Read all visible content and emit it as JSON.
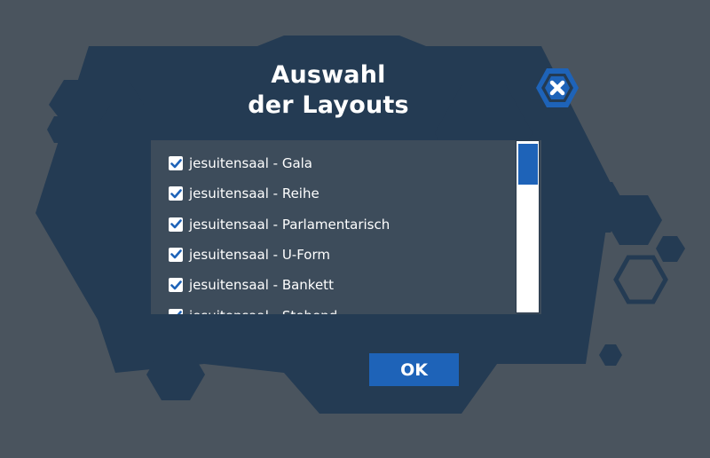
{
  "dialog": {
    "title_line1": "Auswahl",
    "title_line2": "der Layouts",
    "ok_label": "OK"
  },
  "layouts": [
    {
      "label": "jesuitensaal - Gala",
      "checked": true
    },
    {
      "label": "jesuitensaal - Reihe",
      "checked": true
    },
    {
      "label": "jesuitensaal - Parlamentarisch",
      "checked": true
    },
    {
      "label": "jesuitensaal - U-Form",
      "checked": true
    },
    {
      "label": "jesuitensaal - Bankett",
      "checked": true
    },
    {
      "label": "jesuitensaal - Stehend",
      "checked": true
    }
  ],
  "colors": {
    "page_background": "#4a545e",
    "panel": "#243b53",
    "list_background": "#3d4c5b",
    "accent_blue": "#1e63b8",
    "checkbox": "#ffffff",
    "text": "#ffffff"
  },
  "icons": {
    "close": "close-icon",
    "checkbox": "checkmark-icon"
  }
}
